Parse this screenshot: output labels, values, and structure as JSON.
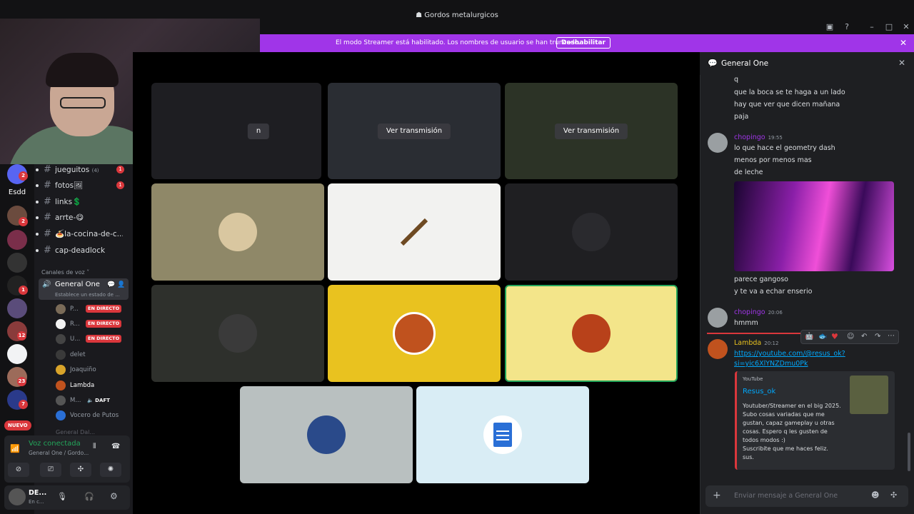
{
  "window": {
    "title": "Gordos metalurgicos"
  },
  "banner": {
    "text": "El modo Streamer está habilitado. Los nombres de usuario se han truncado.",
    "button": "Deshabilitar"
  },
  "rail": {
    "server_label": "Esdd",
    "new_badge": "NUEVO",
    "badges": [
      "2",
      "2",
      "1",
      "12",
      "23",
      "7"
    ]
  },
  "channels": {
    "text": [
      {
        "name": "jueguitos",
        "extra": "(4)",
        "badge": "1"
      },
      {
        "name": "fotos🖼",
        "badge": "1"
      },
      {
        "name": "links💲"
      },
      {
        "name": "arrte-😋"
      },
      {
        "name": "🍝la-cocina-de-c..."
      },
      {
        "name": "cap-deadlock"
      }
    ],
    "voice_category": "Canales de voz",
    "voice_channel": {
      "name": "General One",
      "status": "Establece un estado de ..."
    },
    "voice_users": [
      {
        "name": "P...",
        "live": "EN DIRECTO"
      },
      {
        "name": "R...",
        "live": "EN DIRECTO"
      },
      {
        "name": "U...",
        "live": "EN DIRECTO"
      },
      {
        "name": "delet"
      },
      {
        "name": "Joaquiño"
      },
      {
        "name": "Lambda"
      },
      {
        "name": "M...",
        "tag": "🔈 DAFT"
      },
      {
        "name": "Vocero de Putos"
      }
    ],
    "next_channel": "General Dal..."
  },
  "voice_panel": {
    "status": "Voz conectada",
    "location": "General One / Gordo..."
  },
  "user": {
    "name": "DE...",
    "status": "En c..."
  },
  "stage": {
    "watch_label": "Ver transmisión",
    "partial_label": "n"
  },
  "chat": {
    "title": "General One",
    "lines_top": [
      "q",
      "que la boca se te haga a un lado",
      "hay que ver que dicen mañana",
      "paja"
    ],
    "msg1": {
      "user": "chopingo",
      "time": "19:55",
      "lines": [
        "lo que hace el geometry dash",
        "menos por menos mas",
        "de leche"
      ],
      "after": [
        "parece gangoso",
        "y te va a echar enserio"
      ]
    },
    "msg2": {
      "user": "chopingo",
      "time": "20:06",
      "lines": [
        "hmmm"
      ]
    },
    "msg3": {
      "user": "Lambda",
      "time": "20:12",
      "link1": "https://youtube.com/@resus_ok?",
      "link2": "si=yic6XlYNZDmu0Pk"
    },
    "embed": {
      "provider": "YouTube",
      "title": "Resus_ok",
      "desc": [
        "Youtuber/Streamer en el big 2025.",
        "Subo cosas variadas que me",
        "gustan, capaz gameplay u otras",
        "cosas. Espero q les gusten de",
        "todos modos :)",
        "Suscribite que me haces feliz.",
        "sus."
      ]
    },
    "input_placeholder": "Enviar mensaje a General One"
  }
}
